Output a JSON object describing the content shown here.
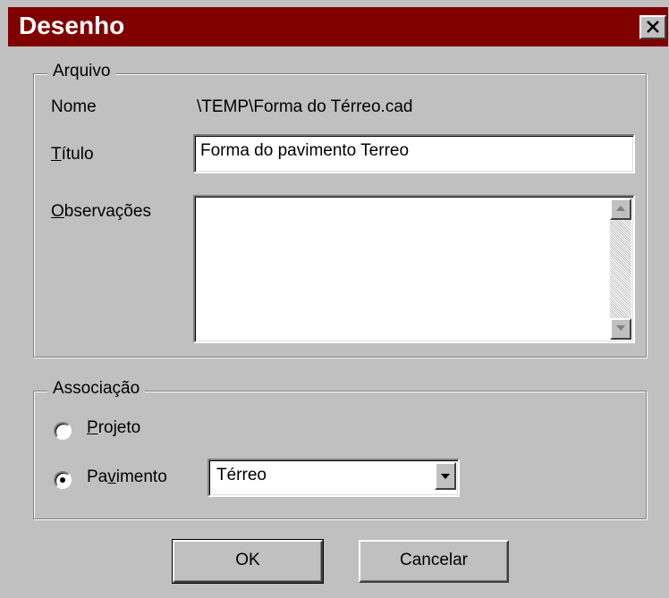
{
  "window": {
    "title": "Desenho",
    "close_icon": "close-icon"
  },
  "arquivo": {
    "legend": "Arquivo",
    "nome_label": "Nome",
    "nome_value": "\\TEMP\\Forma do Térreo.cad",
    "titulo_mnemonic": "T",
    "titulo_rest": "ítulo",
    "titulo_value": "Forma do pavimento Terreo",
    "obs_mnemonic": "O",
    "obs_rest": "bservações",
    "obs_value": ""
  },
  "associacao": {
    "legend": "Associação",
    "projeto_mnemonic": "P",
    "projeto_rest": "rojeto",
    "projeto_selected": false,
    "pavimento_pre": "Pa",
    "pavimento_mnemonic": "v",
    "pavimento_post": "imento",
    "pavimento_selected": true,
    "pavimento_value": "Térreo"
  },
  "buttons": {
    "ok": "OK",
    "cancel": "Cancelar"
  },
  "colors": {
    "titlebar": "#800000",
    "face": "#c0c0c0",
    "field": "#ffffff"
  }
}
